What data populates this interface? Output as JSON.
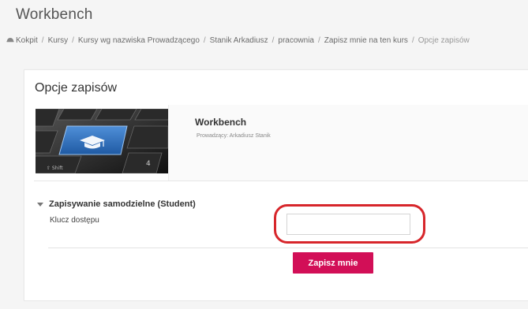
{
  "site": {
    "title": "Workbench"
  },
  "breadcrumb": {
    "items": [
      {
        "label": "Kokpit"
      },
      {
        "label": "Kursy"
      },
      {
        "label": "Kursy wg nazwiska Prowadzącego"
      },
      {
        "label": "Stanik Arkadiusz"
      },
      {
        "label": "pracownia"
      },
      {
        "label": "Zapisz mnie na ten kurs"
      },
      {
        "label": "Opcje zapisów"
      }
    ],
    "separator": "/"
  },
  "main": {
    "title": "Opcje zapisów",
    "course": {
      "name": "Workbench",
      "teacher_label": "Prowadzący:",
      "teacher_name": "Arkadiusz Stanik",
      "image_key_labels": {
        "shift": "⇧ Shift",
        "num": "4"
      }
    },
    "enrolment": {
      "header": "Zapisywanie samodzielne (Student)",
      "key_label": "Klucz dostępu",
      "key_value": "",
      "submit_label": "Zapisz mnie"
    }
  },
  "colors": {
    "accent": "#d20f57",
    "highlight": "#d7262b",
    "key_blue": "#2f6db5"
  },
  "icons": {
    "home": "speedometer-icon",
    "collapse": "chevron-down-icon",
    "key_glyph": "graduation-cap-icon"
  }
}
